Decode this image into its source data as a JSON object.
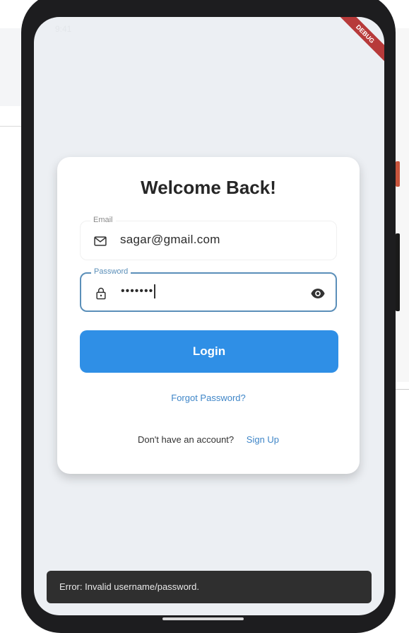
{
  "status_bar": {
    "time": "9:41"
  },
  "debug_banner": "DEBUG",
  "login": {
    "title": "Welcome Back!",
    "email": {
      "label": "Email",
      "value": "sagar@gmail.com",
      "icon": "mail-icon"
    },
    "password": {
      "label": "Password",
      "value": "•••••••",
      "icon": "lock-icon",
      "toggle_icon": "eye-icon"
    },
    "login_button": "Login",
    "forgot_password": "Forgot Password?",
    "signup_prompt": "Don't have an account?",
    "signup_link": "Sign Up"
  },
  "snackbar": {
    "message": "Error: Invalid username/password."
  },
  "colors": {
    "accent": "#2f8fe6",
    "link": "#3f86c8",
    "field_focus": "#5b8fb9",
    "snackbar": "#2f2f2f"
  }
}
